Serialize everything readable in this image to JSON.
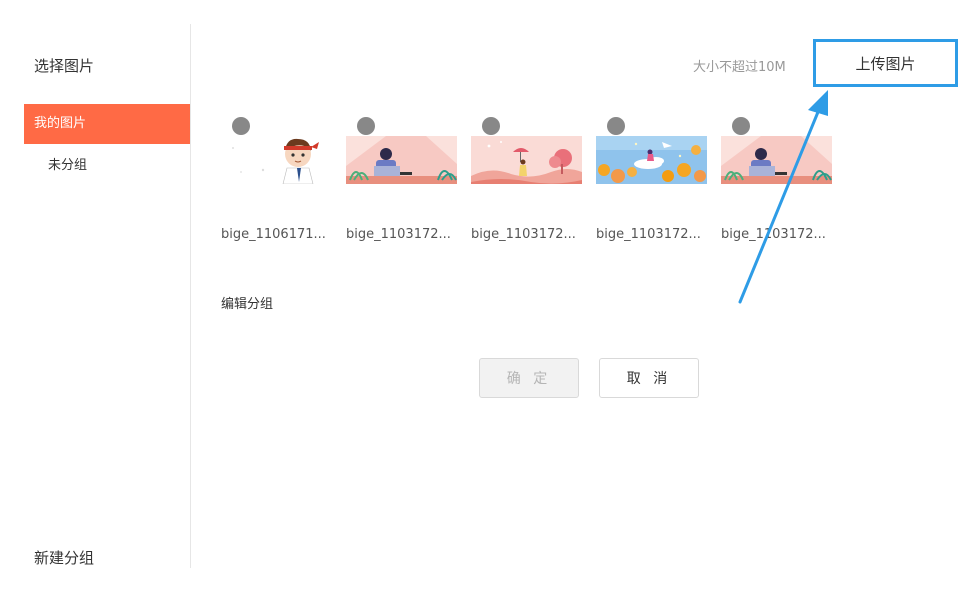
{
  "sidebar": {
    "title": "选择图片",
    "active_item": "我的图片",
    "items": [
      "未分组"
    ],
    "new_group": "新建分组"
  },
  "header": {
    "size_hint": "大小不超过10M",
    "upload_label": "上传图片"
  },
  "images": [
    {
      "name": "bige_1106171...",
      "thumb": "cartoon-boy-icon"
    },
    {
      "name": "bige_1103172...",
      "thumb": "girl-at-laptop-illustration"
    },
    {
      "name": "bige_1103172...",
      "thumb": "girl-with-umbrella-illustration"
    },
    {
      "name": "bige_1103172...",
      "thumb": "girl-on-cloud-illustration"
    },
    {
      "name": "bige_1103172...",
      "thumb": "girl-at-laptop-illustration"
    }
  ],
  "edit_group": "编辑分组",
  "buttons": {
    "ok": "确 定",
    "cancel": "取 消"
  },
  "colors": {
    "accent": "#ff6a45",
    "highlight": "#2e9ce6"
  }
}
